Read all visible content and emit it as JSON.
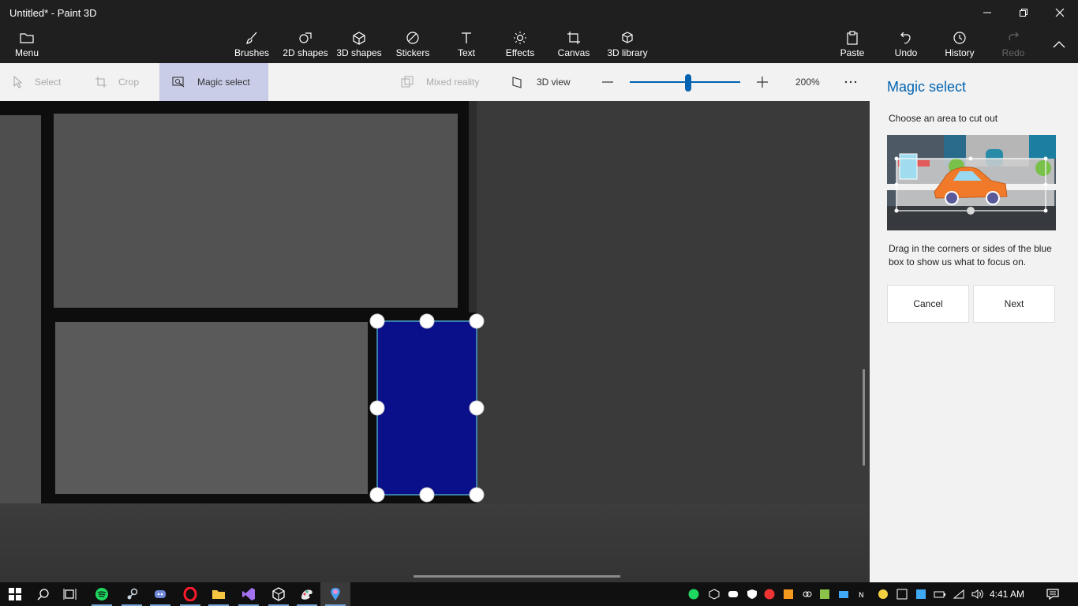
{
  "window": {
    "title": "Untitled* - Paint 3D"
  },
  "ribbon": {
    "menu": "Menu",
    "brushes": "Brushes",
    "shapes2d": "2D shapes",
    "shapes3d": "3D shapes",
    "stickers": "Stickers",
    "text": "Text",
    "effects": "Effects",
    "canvas": "Canvas",
    "library3d": "3D library",
    "paste": "Paste",
    "undo": "Undo",
    "history": "History",
    "redo": "Redo"
  },
  "toolbar": {
    "select": "Select",
    "crop": "Crop",
    "magic_select": "Magic select",
    "mixed_reality": "Mixed reality",
    "view3d": "3D view",
    "zoom": "200%",
    "zoom_fraction": 0.53
  },
  "panel": {
    "title": "Magic select",
    "subtitle": "Choose an area to cut out",
    "instructions": "Drag in the corners or sides of the blue box to show us what to focus on.",
    "cancel": "Cancel",
    "next": "Next"
  },
  "taskbar": {
    "time": "4:41 AM",
    "apps": [
      "start-icon",
      "search-icon",
      "task-view-icon",
      "spotify-icon",
      "steam-icon",
      "discord-icon",
      "opera-icon",
      "file-explorer-icon",
      "visual-studio-icon",
      "unity-icon",
      "paint-icon",
      "paint-3d-icon"
    ]
  },
  "colors": {
    "accent": "#0063b1",
    "selection_fill": "#0a0f8a",
    "chrome_dark": "#1f1f1f",
    "panel_bg": "#f2f2f2"
  }
}
